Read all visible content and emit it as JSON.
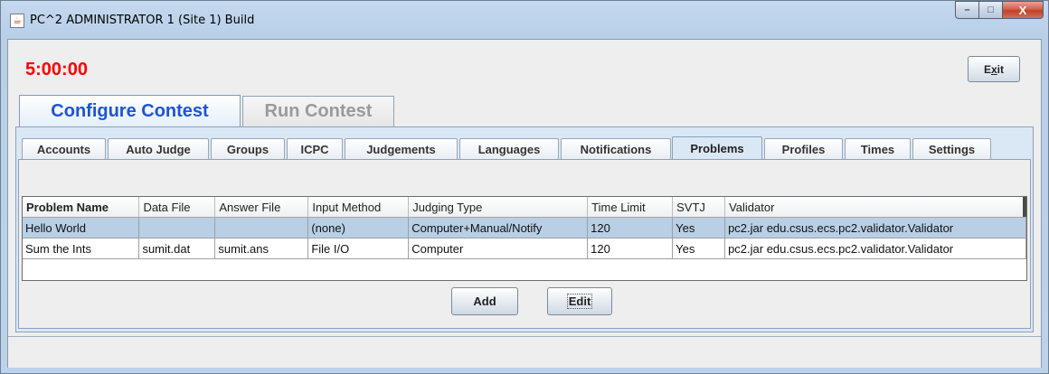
{
  "window": {
    "title": "PC^2 ADMINISTRATOR 1 (Site 1) Build",
    "icon": "java-cup-icon",
    "controls": {
      "minimize": "–",
      "maximize": "□",
      "close": "X"
    }
  },
  "timer": "5:00:00",
  "exit_button": {
    "label_pre": "E",
    "label_mnemonic": "x",
    "label_post": "it"
  },
  "top_tabs": [
    {
      "label": "Configure Contest",
      "active": true
    },
    {
      "label": "Run Contest",
      "active": false
    }
  ],
  "sub_tabs": [
    {
      "label": "Accounts"
    },
    {
      "label": "Auto Judge"
    },
    {
      "label": "Groups"
    },
    {
      "label": "ICPC"
    },
    {
      "label": "Judgements"
    },
    {
      "label": "Languages"
    },
    {
      "label": "Notifications"
    },
    {
      "label": "Problems",
      "active": true
    },
    {
      "label": "Profiles"
    },
    {
      "label": "Times"
    },
    {
      "label": "Settings"
    }
  ],
  "problems_table": {
    "columns": [
      "Problem Name",
      "Data File",
      "Answer File",
      "Input Method",
      "Judging Type",
      "Time Limit",
      "SVTJ",
      "Validator"
    ],
    "rows": [
      [
        "Hello World",
        "",
        "",
        "(none)",
        "Computer+Manual/Notify",
        "120",
        "Yes",
        "pc2.jar edu.csus.ecs.pc2.validator.Validator"
      ],
      [
        "Sum the Ints",
        "sumit.dat",
        "sumit.ans",
        "File I/O",
        "Computer",
        "120",
        "Yes",
        "pc2.jar edu.csus.ecs.pc2.validator.Validator"
      ]
    ],
    "selected_row": 0
  },
  "buttons": {
    "add": "Add",
    "edit": "Edit"
  },
  "colors": {
    "timer": "#ff0000",
    "active_tab_text": "#1c55d6",
    "selection": "#b8cfe5"
  }
}
